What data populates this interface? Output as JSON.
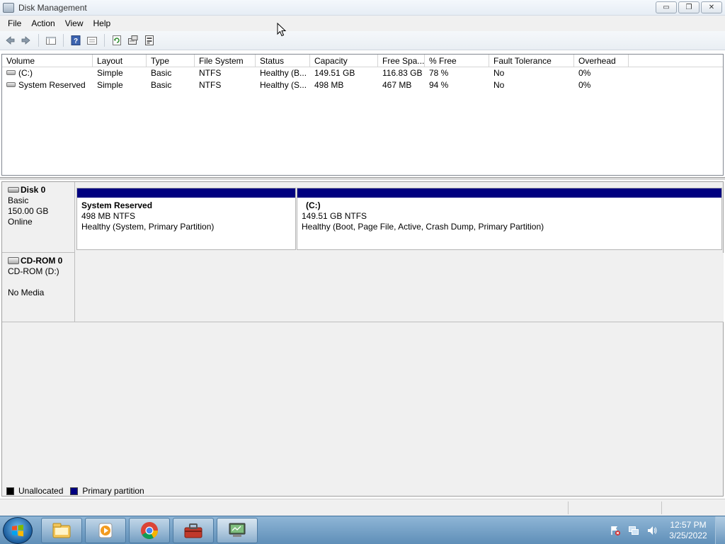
{
  "window": {
    "title": "Disk Management",
    "buttons": {
      "minimize": "▭",
      "restore": "❐",
      "close": "✕"
    }
  },
  "menu": [
    "File",
    "Action",
    "View",
    "Help"
  ],
  "toolbar": {
    "icons": [
      "back-arrow-icon",
      "forward-arrow-icon",
      "show-hide-console-tree-icon",
      "help-icon",
      "properties-icon",
      "refresh-icon",
      "rescan-disks-icon",
      "settings-icon"
    ]
  },
  "volume_list": {
    "columns": [
      "Volume",
      "Layout",
      "Type",
      "File System",
      "Status",
      "Capacity",
      "Free Spa...",
      "% Free",
      "Fault Tolerance",
      "Overhead"
    ],
    "rows": [
      [
        "(C:)",
        "Simple",
        "Basic",
        "NTFS",
        "Healthy (B...",
        "149.51 GB",
        "116.83 GB",
        "78 %",
        "No",
        "0%"
      ],
      [
        "System Reserved",
        "Simple",
        "Basic",
        "NTFS",
        "Healthy (S...",
        "498 MB",
        "467 MB",
        "94 %",
        "No",
        "0%"
      ]
    ]
  },
  "disks": {
    "disk0": {
      "name": "Disk 0",
      "type": "Basic",
      "size": "150.00 GB",
      "state": "Online",
      "partitions": [
        {
          "title": "System Reserved",
          "size": "498 MB NTFS",
          "status": "Healthy (System, Primary Partition)"
        },
        {
          "title": "(C:)",
          "size": "149.51 GB NTFS",
          "status": "Healthy (Boot, Page File, Active, Crash Dump, Primary Partition)"
        }
      ]
    },
    "cdrom0": {
      "name": "CD-ROM 0",
      "drive": "CD-ROM (D:)",
      "media": "No Media"
    }
  },
  "legend": [
    {
      "label": "Unallocated",
      "color": "#000000"
    },
    {
      "label": "Primary partition",
      "color": "#000080"
    }
  ],
  "taskbar": {
    "apps": [
      "explorer-icon",
      "media-player-icon",
      "chrome-icon",
      "toolbox-icon",
      "computer-management-icon"
    ],
    "tray": [
      "action-center-icon",
      "network-icon",
      "volume-icon"
    ],
    "time": "12:57 PM",
    "date": "3/25/2022"
  },
  "colors": {
    "primary_partition": "#000080",
    "taskbar": "#5f8fb8"
  }
}
